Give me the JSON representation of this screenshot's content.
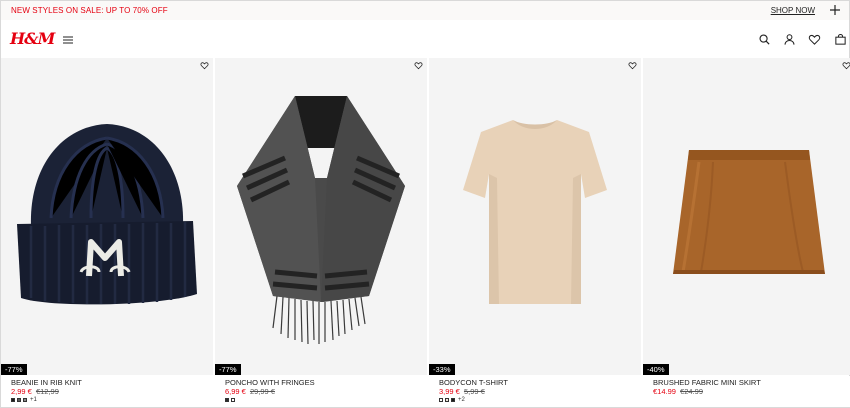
{
  "promo": {
    "text": "NEW STYLES ON SALE: UP TO 70% OFF",
    "link": "SHOP NOW"
  },
  "header": {
    "logo": "H&M"
  },
  "colors": {
    "brand": "#e50010",
    "sale": "#e50010",
    "badge_bg": "#000000"
  },
  "icons": [
    "plus-icon",
    "menu-icon",
    "search-icon",
    "account-icon",
    "heart-icon",
    "bag-icon"
  ],
  "products": [
    {
      "name": "BEANIE IN RIB KNIT",
      "price": "2,99 €",
      "original_price": "€12,99",
      "discount": "-77%",
      "more_colors": "+1",
      "swatches": [
        "#1a1a1a",
        "#5a5a5a",
        "#8a8a8a"
      ]
    },
    {
      "name": "PONCHO WITH FRINGES",
      "price": "6,99 €",
      "original_price": "29,99 €",
      "discount": "-77%",
      "more_colors": "",
      "swatches": [
        "#2b2b2b",
        "#ffffff"
      ]
    },
    {
      "name": "BODYCON T-SHIRT",
      "price": "3,99 €",
      "original_price": "5,99 €",
      "discount": "-33%",
      "more_colors": "+2",
      "swatches": [
        "#ffffff",
        "#efe6da",
        "#1a1a1a"
      ]
    },
    {
      "name": "BRUSHED FABRIC MINI SKIRT",
      "price": "€14.99",
      "original_price": "€24.99",
      "discount": "-40%",
      "more_colors": "",
      "swatches": []
    }
  ]
}
